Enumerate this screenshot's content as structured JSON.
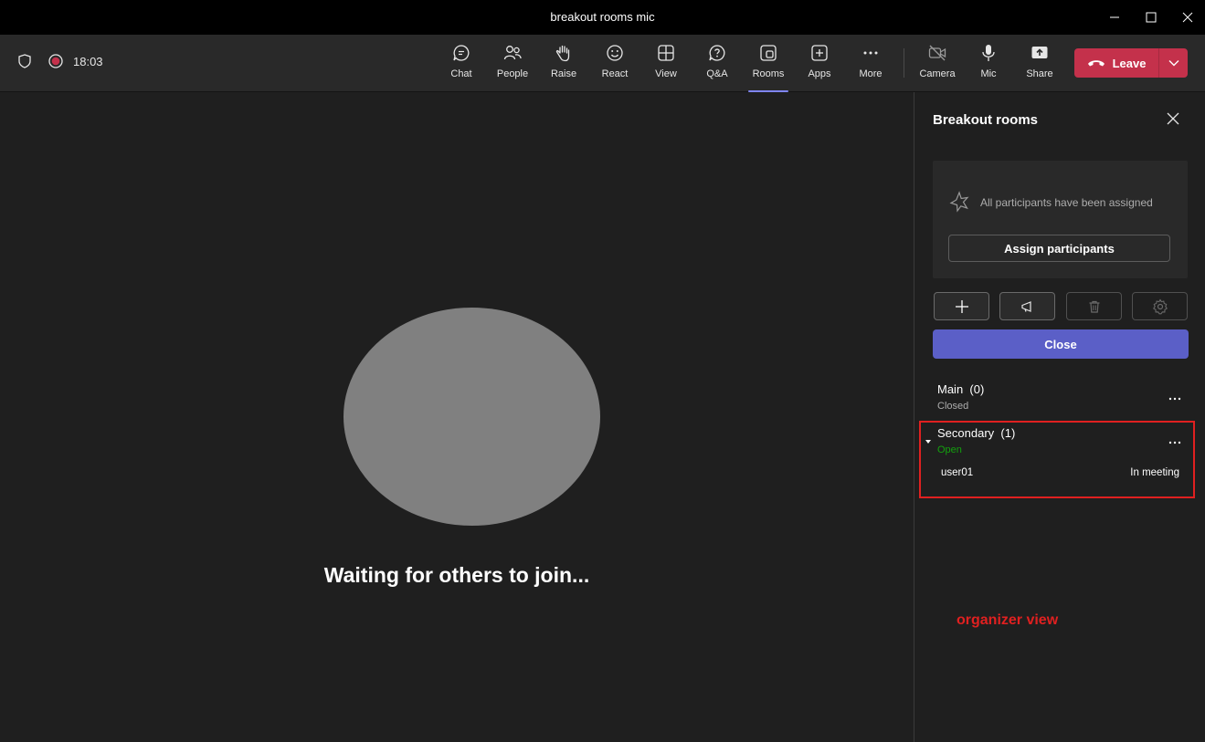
{
  "window": {
    "title": "breakout rooms mic"
  },
  "toolbar": {
    "time": "18:03",
    "items": [
      {
        "label": "Chat",
        "icon": "chat-icon"
      },
      {
        "label": "People",
        "icon": "people-icon"
      },
      {
        "label": "Raise",
        "icon": "raise-hand-icon"
      },
      {
        "label": "React",
        "icon": "react-icon"
      },
      {
        "label": "View",
        "icon": "view-icon"
      },
      {
        "label": "Q&A",
        "icon": "qa-icon"
      },
      {
        "label": "Rooms",
        "icon": "rooms-icon",
        "active": true
      },
      {
        "label": "Apps",
        "icon": "apps-icon"
      },
      {
        "label": "More",
        "icon": "more-icon"
      },
      {
        "label": "Camera",
        "icon": "camera-off-icon"
      },
      {
        "label": "Mic",
        "icon": "mic-icon"
      },
      {
        "label": "Share",
        "icon": "share-icon"
      }
    ],
    "leave_label": "Leave",
    "colors": {
      "leave": "#c4314b",
      "accent": "#7f85f5",
      "record": "#c4314b"
    }
  },
  "stage": {
    "waiting_text": "Waiting for others to join..."
  },
  "panel": {
    "title": "Breakout rooms",
    "assign_message": "All participants have been assigned",
    "assign_button": "Assign participants",
    "actions": [
      "add-room",
      "announcement",
      "delete",
      "settings"
    ],
    "close_button": "Close",
    "close_color": "#5b5fc7",
    "rooms": [
      {
        "name": "Main",
        "count": "(0)",
        "status": "Closed",
        "status_color": "#adadad"
      },
      {
        "name": "Secondary",
        "count": "(1)",
        "status": "Open",
        "status_color": "#13a10e",
        "members": [
          {
            "name": "user01",
            "state": "In meeting"
          }
        ]
      }
    ]
  },
  "annotation": {
    "text": "organizer view",
    "color": "#e02020"
  }
}
